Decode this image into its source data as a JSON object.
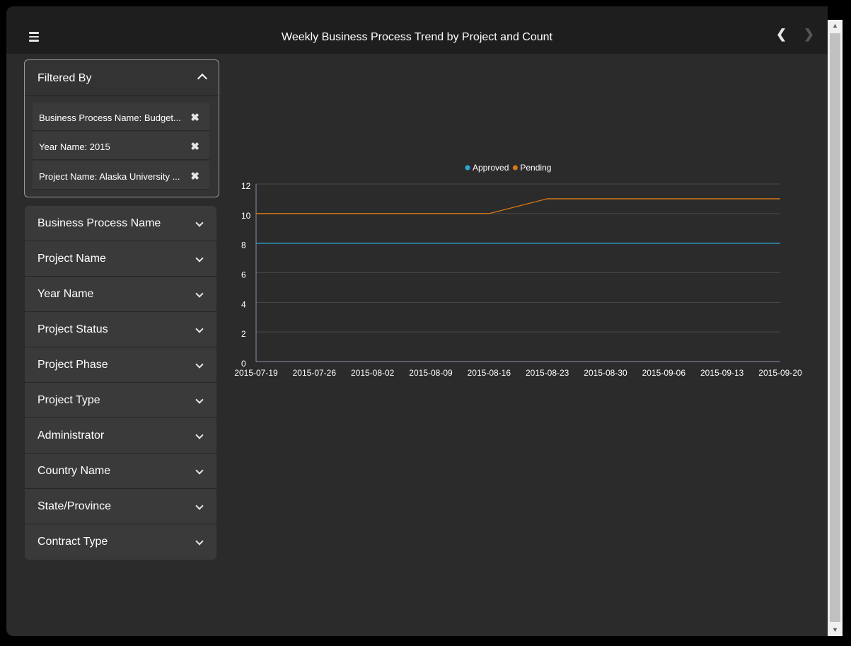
{
  "header": {
    "title": "Weekly Business Process Trend by Project and Count",
    "menu_icon": "hamburger-menu-icon",
    "prev_icon": "chevron-left-icon",
    "next_icon": "chevron-right-icon"
  },
  "filters": {
    "title": "Filtered By",
    "chips": [
      {
        "label": "Business Process Name: Budget..."
      },
      {
        "label": "Year Name: 2015"
      },
      {
        "label": "Project Name: Alaska University ..."
      }
    ]
  },
  "accordion": [
    {
      "label": "Business Process Name"
    },
    {
      "label": "Project Name"
    },
    {
      "label": "Year Name"
    },
    {
      "label": "Project Status"
    },
    {
      "label": "Project Phase"
    },
    {
      "label": "Project Type"
    },
    {
      "label": "Administrator"
    },
    {
      "label": "Country Name"
    },
    {
      "label": "State/Province"
    },
    {
      "label": "Contract Type"
    }
  ],
  "chart_data": {
    "type": "line",
    "categories": [
      "2015-07-19",
      "2015-07-26",
      "2015-08-02",
      "2015-08-09",
      "2015-08-16",
      "2015-08-23",
      "2015-08-30",
      "2015-09-06",
      "2015-09-13",
      "2015-09-20"
    ],
    "series": [
      {
        "name": "Approved",
        "color": "#2ea8d8",
        "values": [
          8,
          8,
          8,
          8,
          8,
          8,
          8,
          8,
          8,
          8
        ]
      },
      {
        "name": "Pending",
        "color": "#d97a16",
        "values": [
          10,
          10,
          10,
          10,
          10,
          11,
          11,
          11,
          11,
          11
        ]
      }
    ],
    "yticks": [
      0,
      2,
      4,
      6,
      8,
      10,
      12
    ],
    "ylim": [
      0,
      12
    ],
    "legend": "top-center",
    "grid": true
  }
}
